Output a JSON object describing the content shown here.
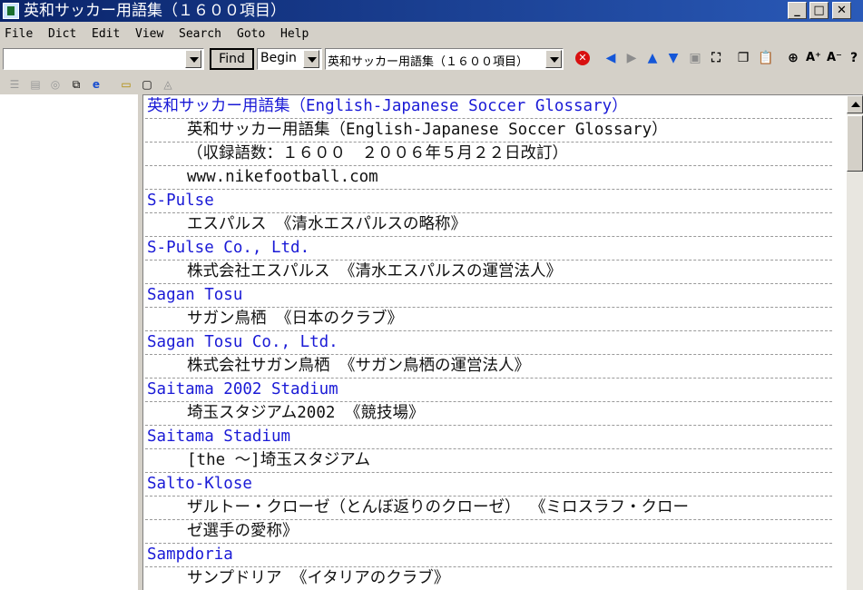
{
  "window": {
    "title": "英和サッカー用語集（１６００項目）"
  },
  "menu": [
    "File",
    "Dict",
    "Edit",
    "View",
    "Search",
    "Goto",
    "Help"
  ],
  "toolbar": {
    "search_value": "",
    "find_label": "Find",
    "match_mode": "Begin",
    "dictionary": "英和サッカー用語集（１６００項目）"
  },
  "icons": {
    "stop": "stop-icon",
    "back": "arrow-left-icon",
    "forward": "arrow-right-icon",
    "up": "arrow-up-icon",
    "down": "arrow-down-icon",
    "copy": "copy-icon",
    "paste": "paste-icon",
    "zoom": "zoom-icon",
    "font_up": "font-increase-icon",
    "font_down": "font-decrease-icon",
    "help": "help-icon"
  },
  "colors": {
    "headword": "#1a1ad6",
    "titlebar": "#0a246a",
    "stop": "#d81010",
    "nav": "#1456d8"
  },
  "entries": [
    {
      "type": "head",
      "text": "英和サッカー用語集（English-Japanese Soccer Glossary）"
    },
    {
      "type": "body",
      "text": "英和サッカー用語集（English-Japanese Soccer Glossary）"
    },
    {
      "type": "body",
      "text": "（収録語数：１６００　２００６年５月２２日改訂）"
    },
    {
      "type": "body",
      "text": " www.nikefootball.com"
    },
    {
      "type": "head",
      "text": "S-Pulse"
    },
    {
      "type": "body",
      "text": "エスパルス 《清水エスパルスの略称》"
    },
    {
      "type": "head",
      "text": "S-Pulse Co., Ltd."
    },
    {
      "type": "body",
      "text": "株式会社エスパルス 《清水エスパルスの運営法人》"
    },
    {
      "type": "head",
      "text": "Sagan Tosu"
    },
    {
      "type": "body",
      "text": "サガン鳥栖 《日本のクラブ》"
    },
    {
      "type": "head",
      "text": "Sagan Tosu Co., Ltd."
    },
    {
      "type": "body",
      "text": "株式会社サガン鳥栖 《サガン鳥栖の運営法人》"
    },
    {
      "type": "head",
      "text": "Saitama 2002 Stadium"
    },
    {
      "type": "body",
      "text": "埼玉スタジアム2002 《競技場》"
    },
    {
      "type": "head",
      "text": "Saitama Stadium"
    },
    {
      "type": "body",
      "text": "[the ～]埼玉スタジアム"
    },
    {
      "type": "head",
      "text": "Salto-Klose"
    },
    {
      "type": "body",
      "text": "ザルトー・クローゼ（とんぼ返りのクローゼ） 《ミロスラフ・クロー"
    },
    {
      "type": "body",
      "text": "ゼ選手の愛称》"
    },
    {
      "type": "head",
      "text": "Sampdoria"
    },
    {
      "type": "body",
      "text": "サンプドリア 《イタリアのクラブ》"
    }
  ]
}
